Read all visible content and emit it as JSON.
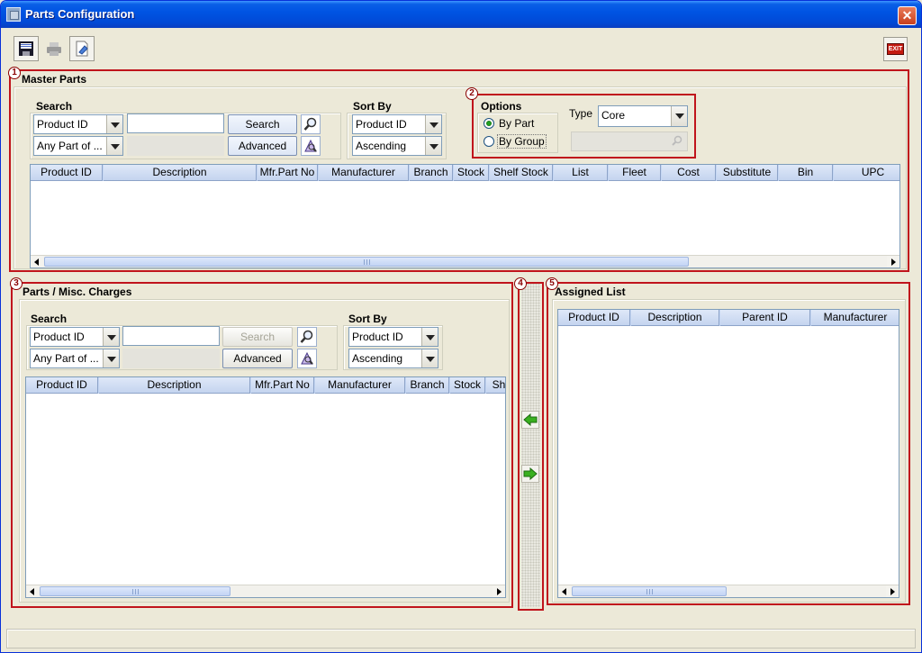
{
  "window": {
    "title": "Parts Configuration"
  },
  "toolbar": {
    "buttons": [
      {
        "icon": "save-disk-icon"
      },
      {
        "icon": "printer-icon"
      },
      {
        "icon": "eraser-document-icon"
      }
    ],
    "exit_label": "EXIT"
  },
  "badges": [
    "1",
    "2",
    "3",
    "4",
    "5"
  ],
  "master": {
    "title": "Master Parts",
    "search": {
      "label": "Search",
      "field": "Product ID",
      "match": "Any Part of ...",
      "search_button": "Search",
      "advanced_button": "Advanced"
    },
    "sort": {
      "label": "Sort By",
      "field": "Product ID",
      "order": "Ascending"
    },
    "options": {
      "label": "Options",
      "by_part": "By Part",
      "by_group": "By Group",
      "selected": "By Part",
      "type_label": "Type",
      "type_value": "Core"
    },
    "columns": [
      "Product ID",
      "Description",
      "Mfr.Part No",
      "Manufacturer",
      "Branch",
      "Stock",
      "Shelf Stock",
      "List",
      "Fleet",
      "Cost",
      "Substitute",
      "Bin",
      "UPC"
    ]
  },
  "parts": {
    "title": "Parts / Misc. Charges",
    "search": {
      "label": "Search",
      "field": "Product ID",
      "match": "Any Part of ...",
      "search_button": "Search",
      "advanced_button": "Advanced"
    },
    "sort": {
      "label": "Sort By",
      "field": "Product ID",
      "order": "Ascending"
    },
    "columns": [
      "Product ID",
      "Description",
      "Mfr.Part No",
      "Manufacturer",
      "Branch",
      "Stock",
      "Sh"
    ]
  },
  "assigned": {
    "title": "Assigned List",
    "columns": [
      "Product ID",
      "Description",
      "Parent ID",
      "Manufacturer"
    ]
  },
  "colors": {
    "title_bar": "#0054e3",
    "highlight_border": "#c0141c",
    "window_bg": "#ece9d8"
  }
}
